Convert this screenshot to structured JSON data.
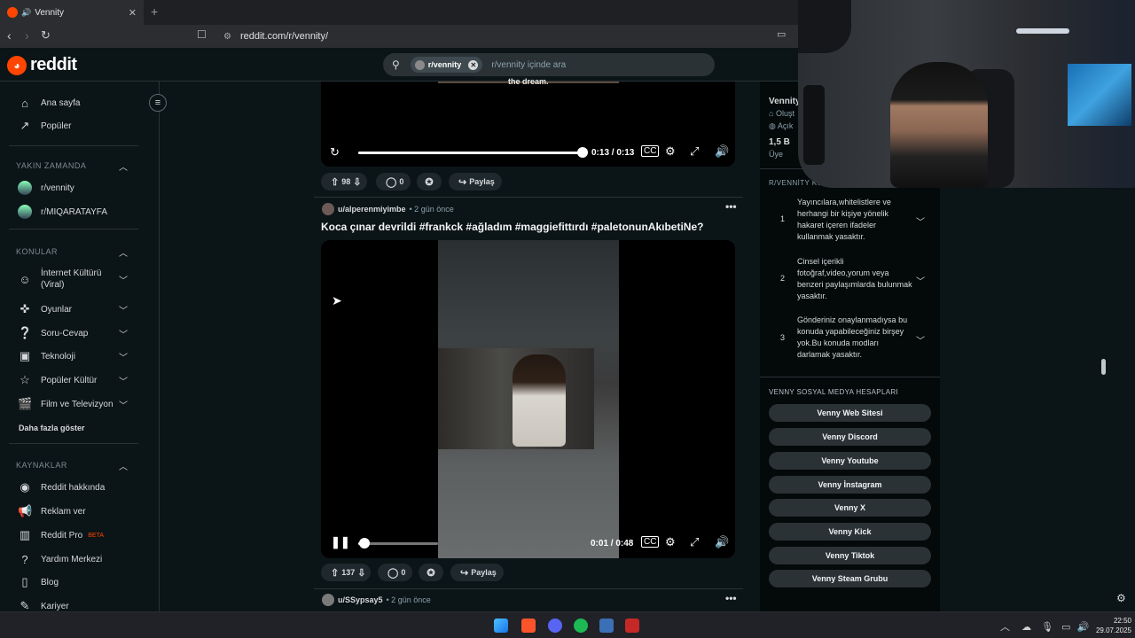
{
  "browser": {
    "tab_title": "Vennity",
    "url": "reddit.com/r/vennity/"
  },
  "reddit": {
    "logo_text": "reddit",
    "search_chip": "r/vennity",
    "search_placeholder": "r/vennity içinde ara"
  },
  "sidebar": {
    "home": "Ana sayfa",
    "popular": "Popüler",
    "recent_header": "YAKIN ZAMANDA",
    "recent": [
      "r/vennity",
      "r/MIQARATAYFA"
    ],
    "topics_header": "KONULAR",
    "topics": [
      "İnternet Kültürü (Viral)",
      "Oyunlar",
      "Soru-Cevap",
      "Teknoloji",
      "Popüler Kültür",
      "Film ve Televizyon"
    ],
    "show_more": "Daha fazla göster",
    "resources_header": "KAYNAKLAR",
    "resources": [
      "Reddit hakkında",
      "Reklam ver",
      "Reddit Pro",
      "Yardım Merkezi",
      "Blog",
      "Kariyer"
    ],
    "beta_badge": "BETA"
  },
  "feed": {
    "post1": {
      "caption_fragment": "the dream.",
      "time": "0:13 / 0:13",
      "votes": "98",
      "comments": "0",
      "share": "Paylaş"
    },
    "post2": {
      "author": "u/alperenmiyimbe",
      "age": "• 2 gün önce",
      "title": "Koca çınar devrildi #frankck #ağladım #maggiefittırdı #paletonunAkıbetiNe?",
      "time": "0:01 / 0:48",
      "progress": 0.02,
      "votes": "137",
      "comments": "0",
      "share": "Paylaş"
    },
    "post3": {
      "author": "u/SSypsay5",
      "age": "• 2 gün önce"
    }
  },
  "right_sidebar": {
    "community_name": "Vennity",
    "created_fragment": "Oluşt",
    "public_fragment": "Açık",
    "members_count": "1,5 B",
    "members_label": "Üye",
    "rules_header": "R/VENNİTY KU",
    "rules": [
      {
        "num": "1",
        "text": "Yayıncılara,whitelistlere ve herhangi bir kişiye yönelik hakaret içeren ifadeler kullanmak yasaktır."
      },
      {
        "num": "2",
        "text": "Cinsel içerikli fotoğraf,video,yorum veya benzeri paylaşımlarda bulunmak yasaktır."
      },
      {
        "num": "3",
        "text": "Gönderiniz onaylanmadıysa bu konuda yapabileceğiniz birşey yok.Bu konuda modları darlamak yasaktır."
      }
    ],
    "social_header": "VENNY SOSYAL MEDYA HESAPLARI",
    "social_buttons": [
      "Venny Web Sitesi",
      "Venny Discord",
      "Venny Youtube",
      "Venny İnstagram",
      "Venny X",
      "Venny Kick",
      "Venny Tiktok",
      "Venny Steam Grubu"
    ]
  },
  "taskbar": {
    "time": "22:50",
    "date": "29.07.2025"
  },
  "colors": {
    "reddit_orange": "#ff4500",
    "background": "#0b1416"
  }
}
